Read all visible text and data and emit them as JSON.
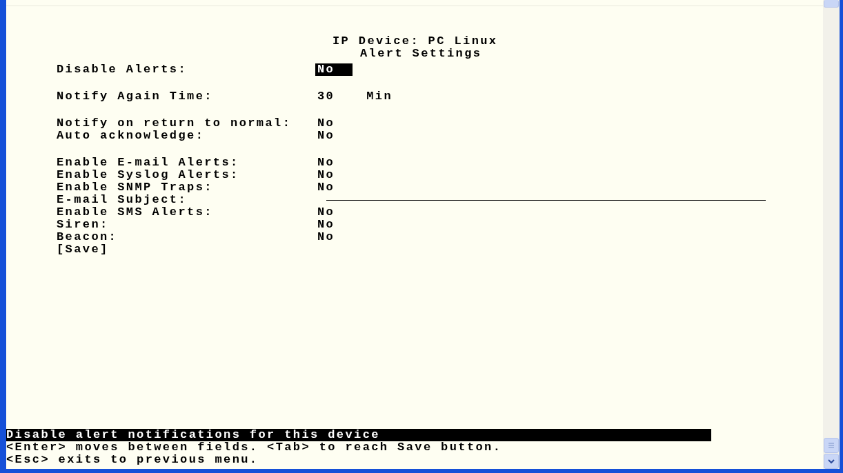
{
  "header": {
    "lines": [
      "IP Device: PC Linux",
      "Alert Settings"
    ]
  },
  "groups": [
    {
      "fields": [
        {
          "label": "Disable Alerts:",
          "kind": "choice",
          "value": "No",
          "selected": true
        }
      ]
    },
    {
      "fields": [
        {
          "label": "Notify Again Time:",
          "kind": "number",
          "value": "30",
          "unit": "Min",
          "selected": false
        }
      ]
    },
    {
      "fields": [
        {
          "label": "Notify on return to normal:",
          "kind": "choice",
          "value": "No",
          "selected": false
        },
        {
          "label": "Auto acknowledge:",
          "kind": "choice",
          "value": "No",
          "selected": false
        }
      ]
    },
    {
      "fields": [
        {
          "label": "Enable E-mail Alerts:",
          "kind": "choice",
          "value": "No",
          "selected": false
        },
        {
          "label": "Enable Syslog Alerts:",
          "kind": "choice",
          "value": "No",
          "selected": false
        },
        {
          "label": "Enable SNMP Traps:",
          "kind": "choice",
          "value": "No",
          "selected": false
        },
        {
          "label": "E-mail Subject:",
          "kind": "text",
          "selected": false
        },
        {
          "label": "Enable SMS Alerts:",
          "kind": "choice",
          "value": "No",
          "selected": false
        },
        {
          "label": "Siren:",
          "kind": "choice",
          "value": "No",
          "selected": false
        },
        {
          "label": "Beacon:",
          "kind": "choice",
          "value": "No",
          "selected": false
        }
      ]
    }
  ],
  "save_button": "[Save]",
  "help": {
    "description": "Disable alert notifications for this device",
    "lines": [
      "<Enter> moves between fields. <Tab> to reach Save button.",
      "<Esc> exits to previous menu."
    ]
  }
}
